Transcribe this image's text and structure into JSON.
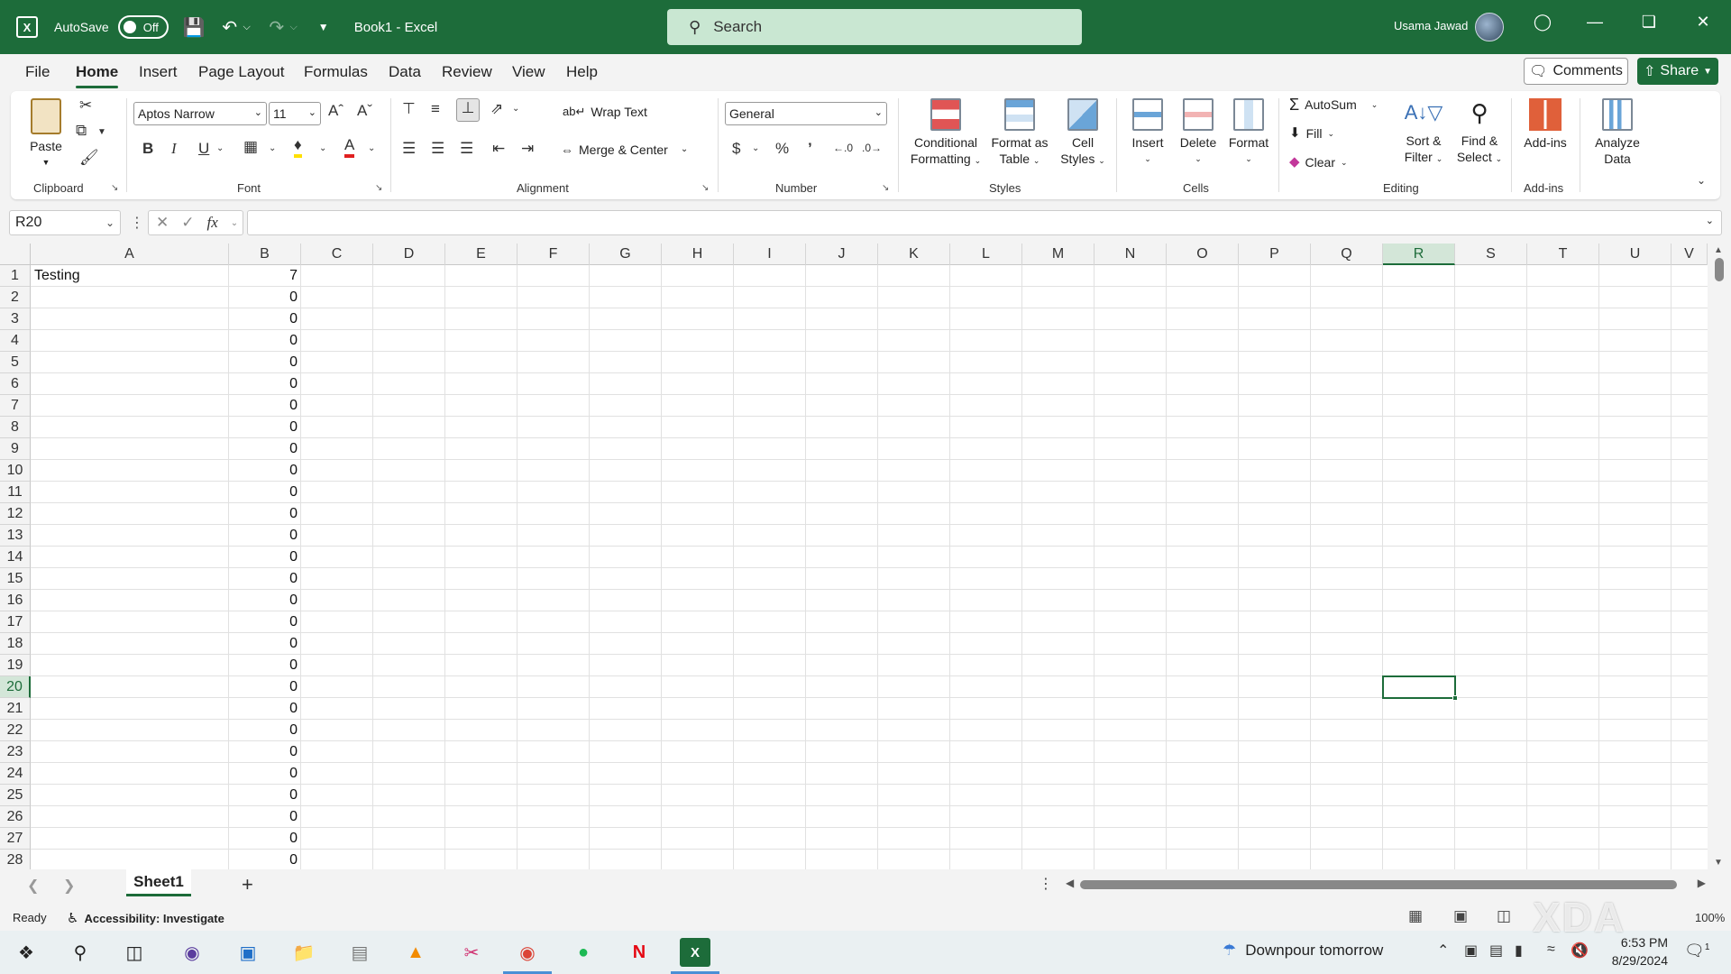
{
  "titlebar": {
    "autosave_label": "AutoSave",
    "autosave_state": "Off",
    "doc_title": "Book1  -  Excel",
    "search_placeholder": "Search",
    "user_name": "Usama Jawad"
  },
  "tabs": [
    "File",
    "Home",
    "Insert",
    "Page Layout",
    "Formulas",
    "Data",
    "Review",
    "View",
    "Help"
  ],
  "active_tab": "Home",
  "comments_label": "Comments",
  "share_label": "Share",
  "ribbon": {
    "clipboard": {
      "label": "Clipboard",
      "paste": "Paste"
    },
    "font": {
      "label": "Font",
      "name": "Aptos Narrow",
      "size": "11"
    },
    "alignment": {
      "label": "Alignment",
      "wrap_text": "Wrap Text",
      "merge_center": "Merge & Center"
    },
    "number": {
      "label": "Number",
      "format": "General"
    },
    "styles": {
      "label": "Styles",
      "conditional_1": "Conditional",
      "conditional_2": "Formatting",
      "format_table_1": "Format as",
      "format_table_2": "Table",
      "cell_styles_1": "Cell",
      "cell_styles_2": "Styles"
    },
    "cells": {
      "label": "Cells",
      "insert": "Insert",
      "delete": "Delete",
      "format": "Format"
    },
    "editing": {
      "label": "Editing",
      "autosum": "AutoSum",
      "fill": "Fill",
      "clear": "Clear",
      "sort_1": "Sort &",
      "sort_2": "Filter",
      "find_1": "Find &",
      "find_2": "Select"
    },
    "addins": {
      "label": "Add-ins",
      "addins": "Add-ins",
      "analyze_1": "Analyze",
      "analyze_2": "Data"
    }
  },
  "formula_bar": {
    "name_box": "R20",
    "formula": ""
  },
  "sheet": {
    "columns": [
      "A",
      "B",
      "C",
      "D",
      "E",
      "F",
      "G",
      "H",
      "I",
      "J",
      "K",
      "L",
      "M",
      "N",
      "O",
      "P",
      "Q",
      "R",
      "S",
      "T",
      "U",
      "V"
    ],
    "rows": [
      "1",
      "2",
      "3",
      "4",
      "5",
      "6",
      "7",
      "8",
      "9",
      "10",
      "11",
      "12",
      "13",
      "14",
      "15",
      "16",
      "17",
      "18",
      "19",
      "20",
      "21",
      "22",
      "23",
      "24",
      "25",
      "26",
      "27",
      "28"
    ],
    "selected_column": "R",
    "selected_row": "20",
    "a1": "Testing",
    "b_values": [
      "7",
      "0",
      "0",
      "0",
      "0",
      "0",
      "0",
      "0",
      "0",
      "0",
      "0",
      "0",
      "0",
      "0",
      "0",
      "0",
      "0",
      "0",
      "0",
      "0",
      "0",
      "0",
      "0",
      "0",
      "0",
      "0",
      "0",
      "0"
    ],
    "tab_name": "Sheet1"
  },
  "status": {
    "ready": "Ready",
    "accessibility": "Accessibility: Investigate",
    "zoom": "100%"
  },
  "taskbar": {
    "weather": "Downpour tomorrow",
    "time": "6:53 PM",
    "date": "8/29/2024",
    "notif_count": "1"
  },
  "watermark": "XDA",
  "colors": {
    "excel_green": "#1d6c3a",
    "search_bg": "#c9e7d2",
    "selection_bg": "#d3e6d8"
  }
}
